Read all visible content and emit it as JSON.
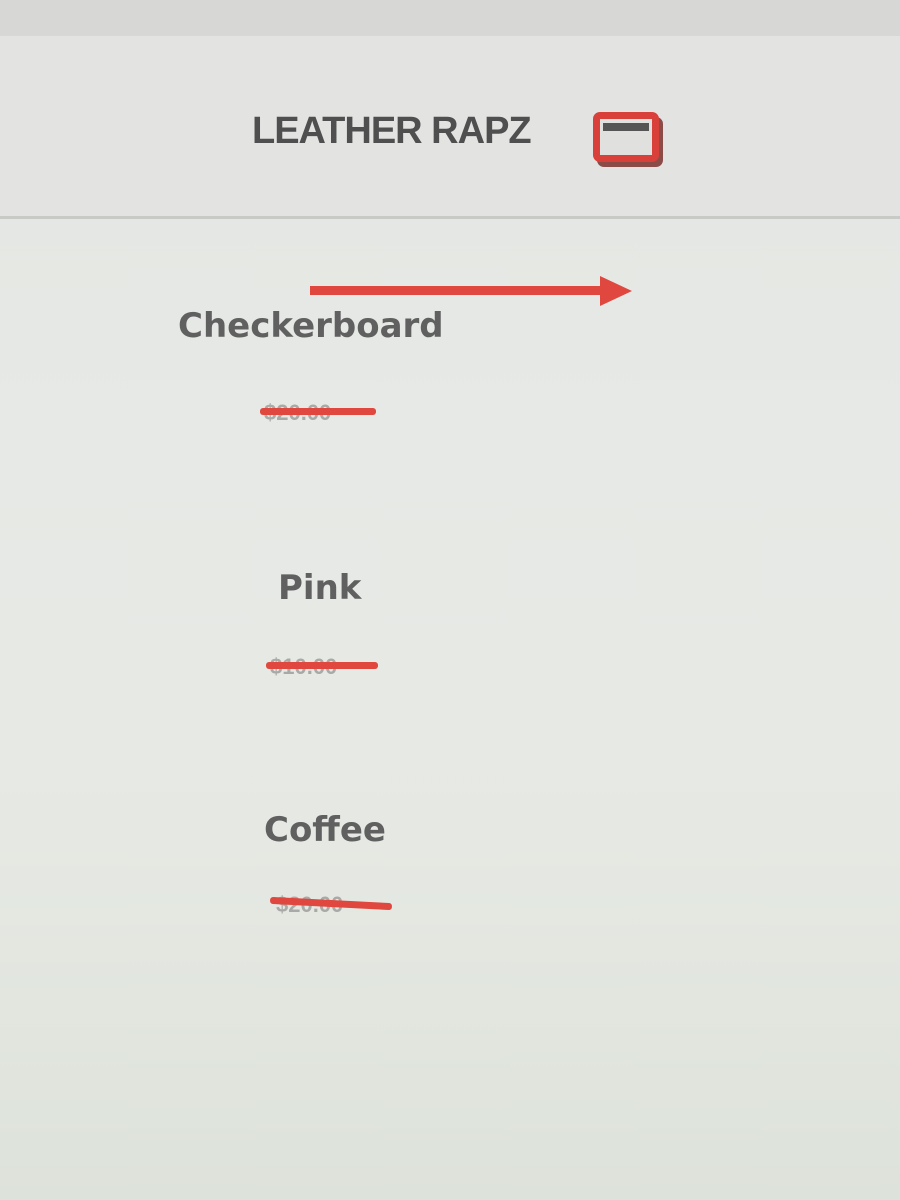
{
  "header": {
    "brand": "LEATHER RAPZ",
    "cart_icon": "cart-icon"
  },
  "annotation": {
    "arrow_icon": "arrow-right-icon",
    "color": "#e0473f"
  },
  "products": [
    {
      "name": "Checkerboard",
      "price": "$20.00",
      "price_struck_through": true
    },
    {
      "name": "Pink",
      "price": "$10.00",
      "price_struck_through": true
    },
    {
      "name": "Coffee",
      "price": "$20.00",
      "price_struck_through": true
    }
  ],
  "colors": {
    "accent_red": "#d9403a",
    "text_dark": "#4e4f4e",
    "text_muted": "#a9aaa8"
  }
}
